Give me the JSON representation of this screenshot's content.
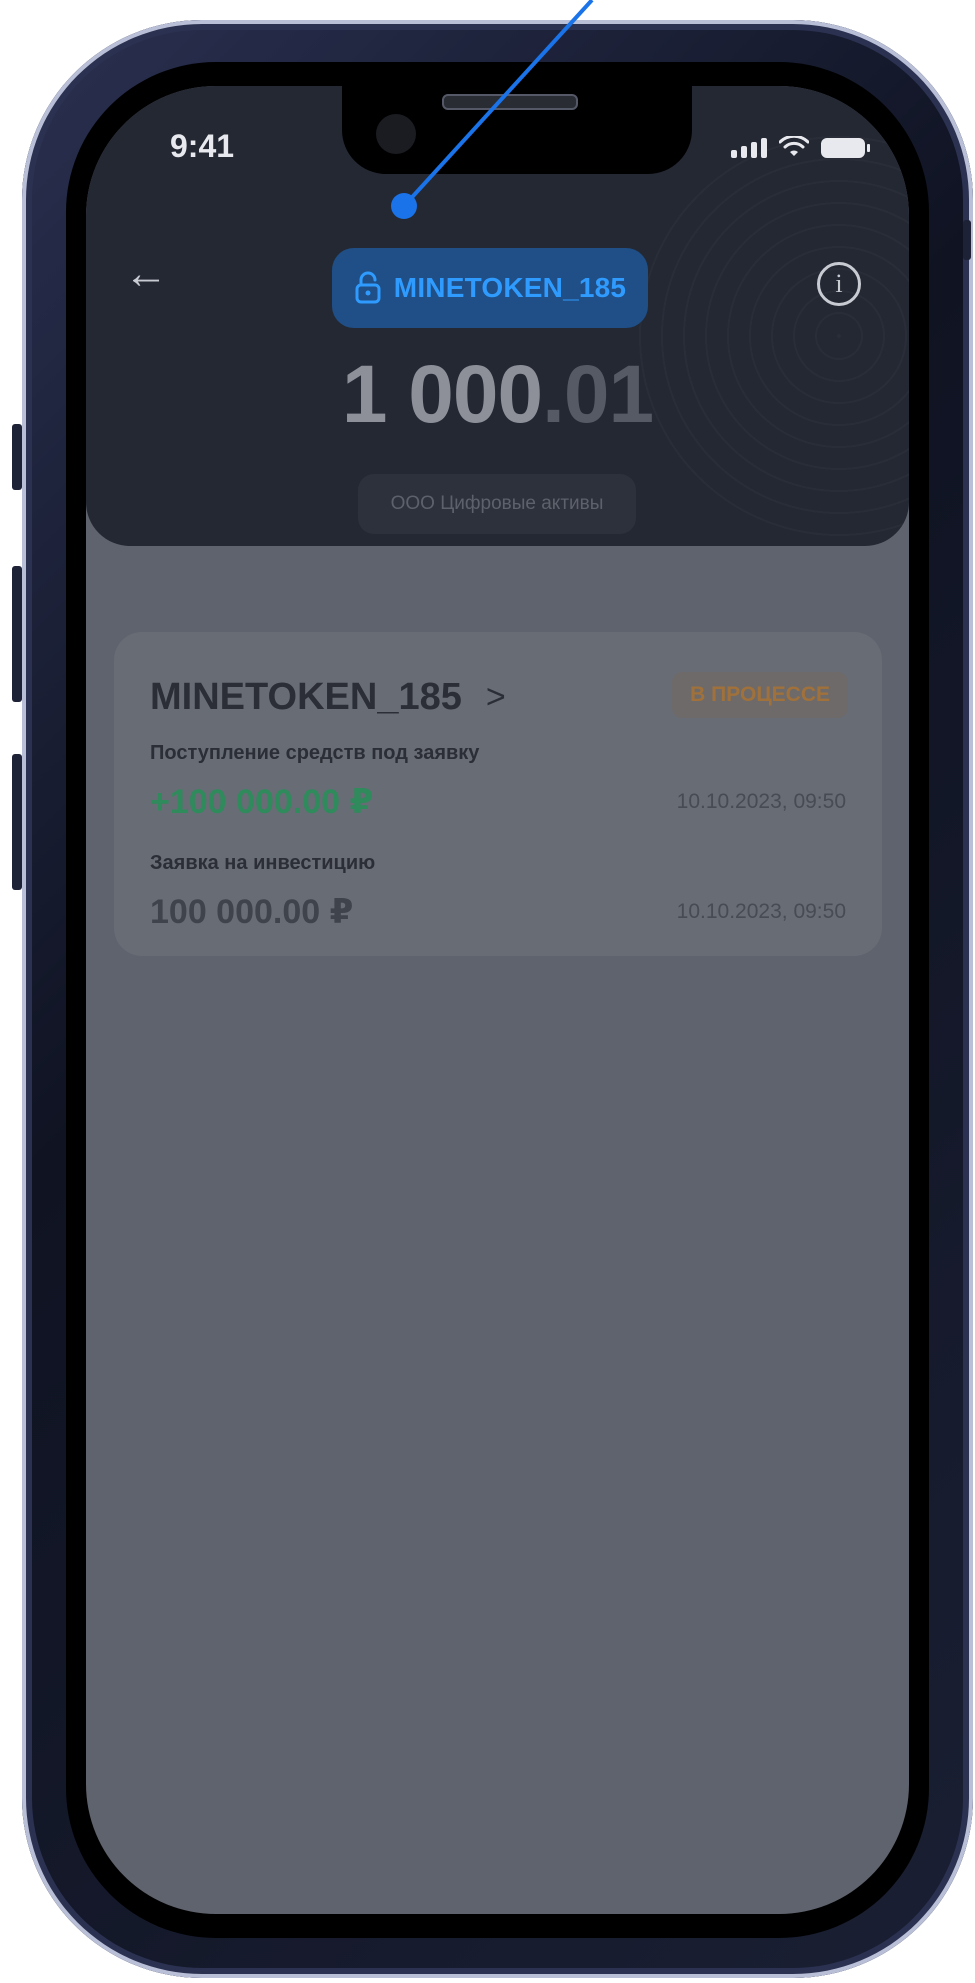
{
  "status_bar": {
    "time": "9:41"
  },
  "header": {
    "token_name": "MINETOKEN_185",
    "balance_int": "1 000",
    "balance_frac": ".01",
    "company": "ООО Цифровые активы"
  },
  "card": {
    "title": "MINETOKEN_185",
    "status": "В ПРОЦЕССЕ",
    "rows": [
      {
        "label": "Поступление средств под заявку",
        "amount": "+100 000.00 ₽",
        "date": "10.10.2023, 09:50"
      },
      {
        "label": "Заявка на инвестицию",
        "amount": "100 000.00 ₽",
        "date": "10.10.2023, 09:50"
      }
    ]
  },
  "colors": {
    "accent_blue": "#1a73e8",
    "positive_green": "#2f8a5c",
    "status_orange": "#a0713a"
  },
  "icons": [
    "back-arrow-icon",
    "lock-icon",
    "info-icon",
    "chevron-right-icon",
    "signal-icon",
    "wifi-icon",
    "battery-icon"
  ]
}
